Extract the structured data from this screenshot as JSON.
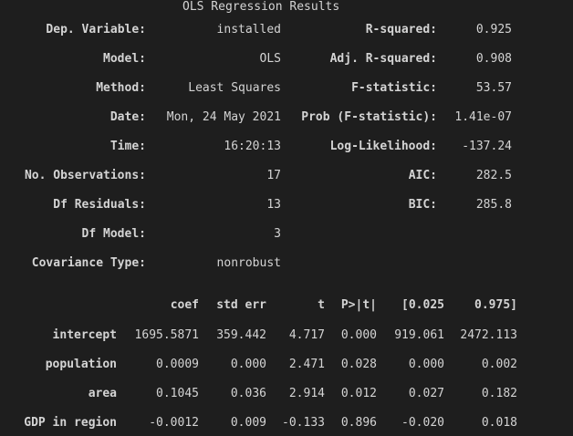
{
  "title": "OLS Regression Results",
  "summary": {
    "left": [
      {
        "label": "Dep. Variable:",
        "value": "installed"
      },
      {
        "label": "Model:",
        "value": "OLS"
      },
      {
        "label": "Method:",
        "value": "Least Squares"
      },
      {
        "label": "Date:",
        "value": "Mon, 24 May 2021"
      },
      {
        "label": "Time:",
        "value": "16:20:13"
      },
      {
        "label": "No. Observations:",
        "value": "17"
      },
      {
        "label": "Df Residuals:",
        "value": "13"
      },
      {
        "label": "Df Model:",
        "value": "3"
      },
      {
        "label": "Covariance Type:",
        "value": "nonrobust"
      }
    ],
    "right": [
      {
        "label": "R-squared:",
        "value": "0.925"
      },
      {
        "label": "Adj. R-squared:",
        "value": "0.908"
      },
      {
        "label": "F-statistic:",
        "value": "53.57"
      },
      {
        "label": "Prob (F-statistic):",
        "value": "1.41e-07"
      },
      {
        "label": "Log-Likelihood:",
        "value": "-137.24"
      },
      {
        "label": "AIC:",
        "value": "282.5"
      },
      {
        "label": "BIC:",
        "value": "285.8"
      }
    ]
  },
  "coef_table": {
    "headers": [
      "coef",
      "std err",
      "t",
      "P>|t|",
      "[0.025",
      "0.975]"
    ],
    "rows": [
      {
        "name": "intercept",
        "values": [
          "1695.5871",
          "359.442",
          "4.717",
          "0.000",
          "919.061",
          "2472.113"
        ]
      },
      {
        "name": "population",
        "values": [
          "0.0009",
          "0.000",
          "2.471",
          "0.028",
          "0.000",
          "0.002"
        ]
      },
      {
        "name": "area",
        "values": [
          "0.1045",
          "0.036",
          "2.914",
          "0.012",
          "0.027",
          "0.182"
        ]
      },
      {
        "name": "GDP in region",
        "values": [
          "-0.0012",
          "0.009",
          "-0.133",
          "0.896",
          "-0.020",
          "0.018"
        ]
      }
    ]
  }
}
